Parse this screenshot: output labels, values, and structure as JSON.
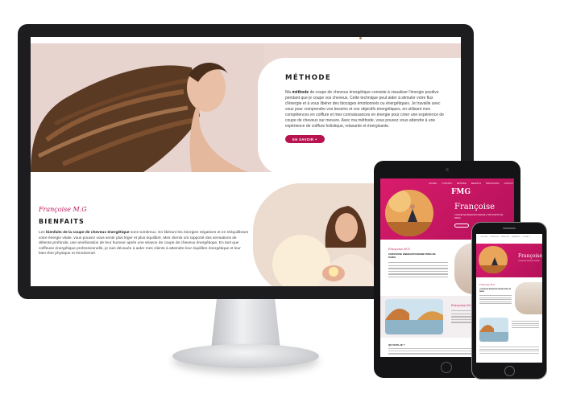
{
  "colors": {
    "accent": "#b8124f",
    "hero_band": "#ead7d2",
    "mobile_hero": "#d91c6c",
    "device_frame": "#1d1d1f"
  },
  "desktop": {
    "method": {
      "title": "MÉTHODE",
      "paragraph_prefix": "Ma ",
      "paragraph_bold": "méthode",
      "paragraph_rest": " de coupe de cheveux énergétique consiste à visualiser l'énergie positive pendant que je coupe vos cheveux. Cette technique peut aider à stimuler votre flux d'énergie et à vous libérer des blocages émotionnels ou énergétiques. Je travaille avec vous pour comprendre vos besoins et vos objectifs énergétiques, en utilisant mes compétences en coiffure et mes connaissances en énergie pour créer une expérience de coupe de cheveux sur mesure. Avec ma méthode, vous pouvez vous attendre à une expérience de coiffure holistique, relaxante et énergisante.",
      "button_label": "EN SAVOIR +"
    },
    "benefits": {
      "signature": "Françoise M.G",
      "title": "BIENFAITS",
      "paragraph_prefix": "Les ",
      "paragraph_bold": "bienfaits de la coupe de cheveux énergétique",
      "paragraph_rest": " sont nombreux. En libérant les énergies négatives et en rééquilibrant votre énergie vitale, vous pouvez vous sentir plus léger et plus équilibré. Mes clients ont rapporté des sensations de détente profonde, une amélioration de leur humeur après une séance de coupe de cheveux énergétique. En tant que coiffeuse énergétique professionnelle, je suis dévouée à aider mes clients à atteindre leur équilibre énergétique et leur bien-être physique et émotionnel.",
      "button_label": "→"
    }
  },
  "tablet": {
    "nav": [
      "ACCUEIL",
      "À PROPOS",
      "MÉTHODE",
      "BIENFAITS",
      "PRESTATIONS",
      "CONTACT"
    ],
    "logo": "FMG",
    "hero_name": "Françoise",
    "hero_subtitle": "COIFFEUSE ÉNERGÉTICIENNE À PROXIMITÉ DE PARIS",
    "signature": "Françoise M.G",
    "heading": "COIFFEUSE ÉNERGÉTICIENNE PRÈS DE PARIS",
    "signature2": "Françoise M.G",
    "footer_label": "QUI SUIS-JE ?"
  },
  "phone": {
    "nav": [
      "ACCUEIL",
      "À PROPOS",
      "MÉTHODE",
      "BIENFAITS",
      "CONTACT"
    ],
    "hero_name": "Françoise",
    "hero_subtitle": "COIFFEUSE ÉNERGÉTICIENNE",
    "signature": "Françoise M.G",
    "heading": "COIFFEUSE ÉNERGÉTICIENNE PRÈS DE PARIS"
  }
}
